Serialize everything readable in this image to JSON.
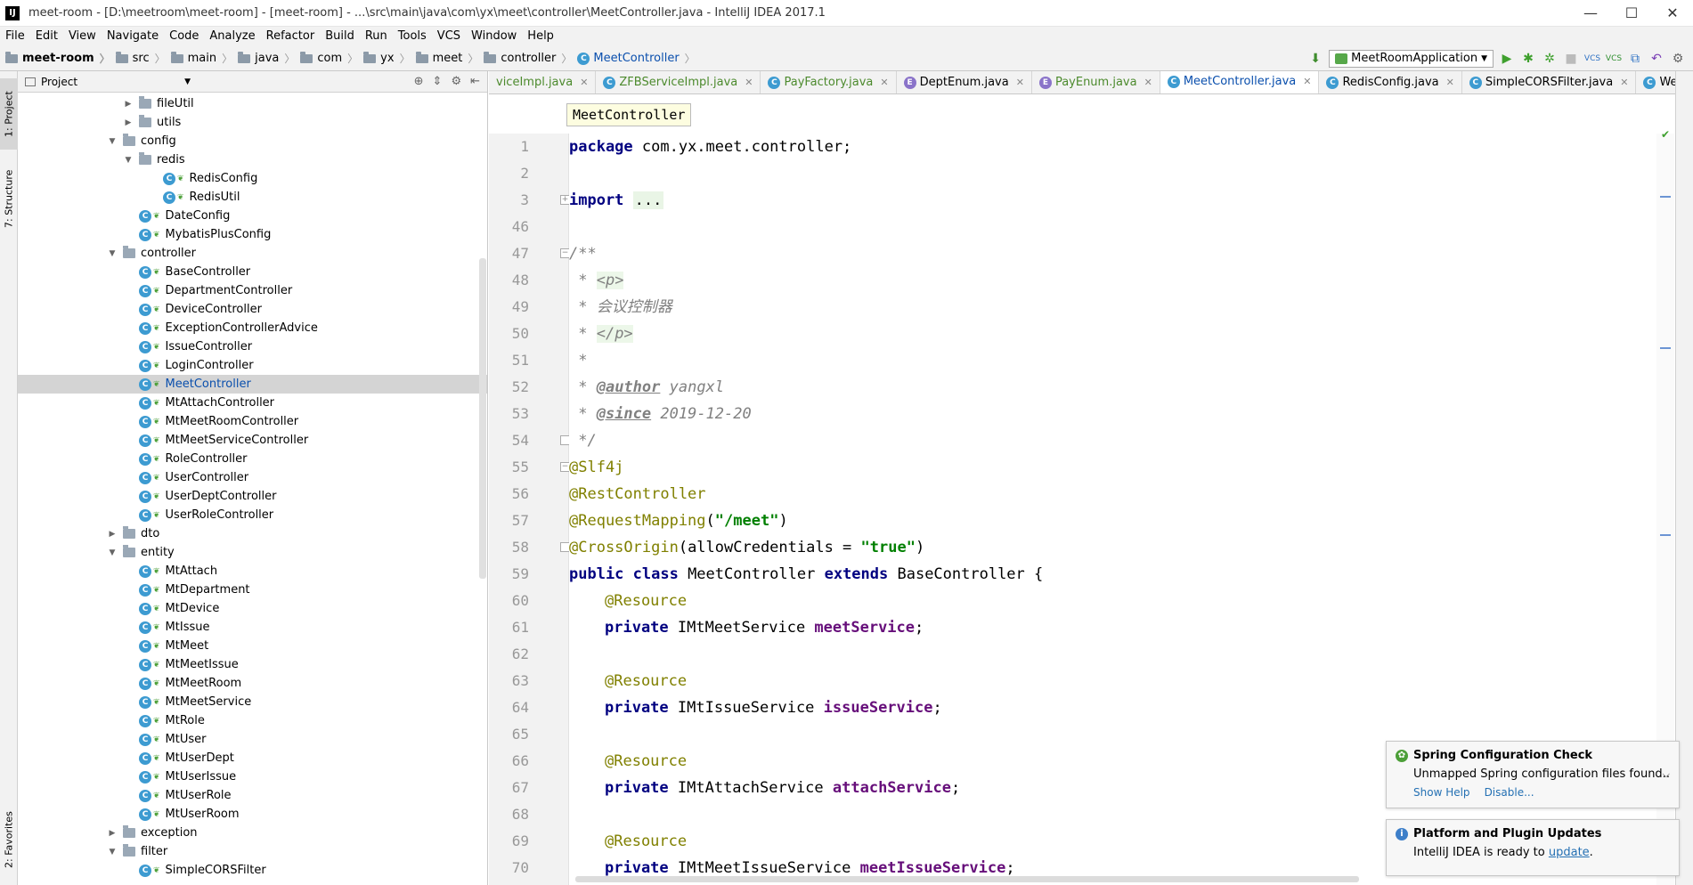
{
  "window": {
    "title": "meet-room - [D:\\meetroom\\meet-room] - [meet-room] - ...\\src\\main\\java\\com\\yx\\meet\\controller\\MeetController.java - IntelliJ IDEA 2017.1",
    "minimize": "—",
    "maximize": "☐",
    "close": "✕"
  },
  "menu": [
    "File",
    "Edit",
    "View",
    "Navigate",
    "Code",
    "Analyze",
    "Refactor",
    "Build",
    "Run",
    "Tools",
    "VCS",
    "Window",
    "Help"
  ],
  "breadcrumb": {
    "project": "meet-room",
    "items": [
      "src",
      "main",
      "java",
      "com",
      "yx",
      "meet",
      "controller"
    ],
    "file": "MeetController"
  },
  "run_config": "MeetRoomApplication",
  "side_tabs": {
    "project": "1: Project",
    "structure": "7: Structure",
    "favorites": "2: Favorites"
  },
  "project_panel": {
    "title": "Project",
    "tree": [
      {
        "label": "fileUtil",
        "type": "pkg",
        "depth": 1,
        "arrow": "▶"
      },
      {
        "label": "utils",
        "type": "pkg",
        "depth": 1,
        "arrow": "▶"
      },
      {
        "label": "config",
        "type": "pkg",
        "depth": 0,
        "arrow": "▼"
      },
      {
        "label": "redis",
        "type": "pkg",
        "depth": 1,
        "arrow": "▼"
      },
      {
        "label": "RedisConfig",
        "type": "class",
        "depth": 2
      },
      {
        "label": "RedisUtil",
        "type": "class",
        "depth": 2
      },
      {
        "label": "DateConfig",
        "type": "class",
        "depth": 1
      },
      {
        "label": "MybatisPlusConfig",
        "type": "class",
        "depth": 1
      },
      {
        "label": "controller",
        "type": "pkg",
        "depth": 0,
        "arrow": "▼"
      },
      {
        "label": "BaseController",
        "type": "class",
        "depth": 1
      },
      {
        "label": "DepartmentController",
        "type": "class",
        "depth": 1
      },
      {
        "label": "DeviceController",
        "type": "class",
        "depth": 1
      },
      {
        "label": "ExceptionControllerAdvice",
        "type": "class",
        "depth": 1
      },
      {
        "label": "IssueController",
        "type": "class",
        "depth": 1
      },
      {
        "label": "LoginController",
        "type": "class",
        "depth": 1
      },
      {
        "label": "MeetController",
        "type": "class",
        "depth": 1,
        "selected": true
      },
      {
        "label": "MtAttachController",
        "type": "class",
        "depth": 1
      },
      {
        "label": "MtMeetRoomController",
        "type": "class",
        "depth": 1
      },
      {
        "label": "MtMeetServiceController",
        "type": "class",
        "depth": 1
      },
      {
        "label": "RoleController",
        "type": "class",
        "depth": 1
      },
      {
        "label": "UserController",
        "type": "class",
        "depth": 1
      },
      {
        "label": "UserDeptController",
        "type": "class",
        "depth": 1
      },
      {
        "label": "UserRoleController",
        "type": "class",
        "depth": 1
      },
      {
        "label": "dto",
        "type": "pkg",
        "depth": 0,
        "arrow": "▶"
      },
      {
        "label": "entity",
        "type": "pkg",
        "depth": 0,
        "arrow": "▼"
      },
      {
        "label": "MtAttach",
        "type": "class",
        "depth": 1
      },
      {
        "label": "MtDepartment",
        "type": "class",
        "depth": 1
      },
      {
        "label": "MtDevice",
        "type": "class",
        "depth": 1
      },
      {
        "label": "MtIssue",
        "type": "class",
        "depth": 1
      },
      {
        "label": "MtMeet",
        "type": "class",
        "depth": 1
      },
      {
        "label": "MtMeetIssue",
        "type": "class",
        "depth": 1
      },
      {
        "label": "MtMeetRoom",
        "type": "class",
        "depth": 1
      },
      {
        "label": "MtMeetService",
        "type": "class",
        "depth": 1
      },
      {
        "label": "MtRole",
        "type": "class",
        "depth": 1
      },
      {
        "label": "MtUser",
        "type": "class",
        "depth": 1
      },
      {
        "label": "MtUserDept",
        "type": "class",
        "depth": 1
      },
      {
        "label": "MtUserIssue",
        "type": "class",
        "depth": 1
      },
      {
        "label": "MtUserRole",
        "type": "class",
        "depth": 1
      },
      {
        "label": "MtUserRoom",
        "type": "class",
        "depth": 1
      },
      {
        "label": "exception",
        "type": "pkg",
        "depth": 0,
        "arrow": "▶"
      },
      {
        "label": "filter",
        "type": "pkg",
        "depth": 0,
        "arrow": "▼"
      },
      {
        "label": "SimpleCORSFilter",
        "type": "class",
        "depth": 1
      }
    ]
  },
  "editor_tabs": [
    {
      "label": "viceImpl.java",
      "kind": "class",
      "green": true
    },
    {
      "label": "ZFBServiceImpl.java",
      "kind": "class",
      "green": true
    },
    {
      "label": "PayFactory.java",
      "kind": "class",
      "green": true
    },
    {
      "label": "DeptEnum.java",
      "kind": "enum",
      "green": false
    },
    {
      "label": "PayEnum.java",
      "kind": "enum",
      "green": true
    },
    {
      "label": "MeetController.java",
      "kind": "class",
      "green": false,
      "active": true
    },
    {
      "label": "RedisConfig.java",
      "kind": "class",
      "green": false
    },
    {
      "label": "SimpleCORSFilter.java",
      "kind": "class",
      "green": false
    },
    {
      "label": "WebMvcConfig.java",
      "kind": "class",
      "green": false
    }
  ],
  "editor": {
    "class_tip": "MeetController",
    "line_numbers": [
      "1",
      "2",
      "3",
      "46",
      "47",
      "48",
      "49",
      "50",
      "51",
      "52",
      "53",
      "54",
      "55",
      "56",
      "57",
      "58",
      "59",
      "60",
      "61",
      "62",
      "63",
      "64",
      "65",
      "66",
      "67",
      "68",
      "69",
      "70"
    ],
    "code": {
      "l1_kw": "package",
      "l1_rest": " com.yx.meet.controller;",
      "l3_kw": "import",
      "l3_folded": "...",
      "l47": "/**",
      "l48_star": " * ",
      "l48_tag": "<p>",
      "l49": " * 会议控制器",
      "l50_star": " * ",
      "l50_tag": "</p>",
      "l51": " *",
      "l52_star": " * ",
      "l52_tag": "@author",
      "l52_val": " yangxl",
      "l53_star": " * ",
      "l53_tag": "@since",
      "l53_val": " 2019-12-20",
      "l54": " */",
      "l55": "@Slf4j",
      "l56": "@RestController",
      "l57_ann": "@RequestMapping",
      "l57_p1": "(",
      "l57_str": "\"/meet\"",
      "l57_p2": ")",
      "l58_ann": "@CrossOrigin",
      "l58_p1": "(allowCredentials = ",
      "l58_str": "\"true\"",
      "l58_p2": ")",
      "l59_kw1": "public class",
      "l59_name": " MeetController ",
      "l59_kw2": "extends",
      "l59_rest": " BaseController {",
      "resource": "@Resource",
      "private_kw": "private",
      "l61_type": " IMtMeetService ",
      "l61_field": "meetService",
      "l64_type": " IMtIssueService ",
      "l64_field": "issueService",
      "l67_type": " IMtAttachService ",
      "l67_field": "attachService",
      "l70_type": " IMtMeetIssueService ",
      "l70_field": "meetIssueService",
      "semicolon": ";"
    }
  },
  "notifications": [
    {
      "title": "Spring Configuration Check",
      "body": "Unmapped Spring configuration files found....",
      "links": [
        "Show Help",
        "Disable..."
      ],
      "icon_color": "#4c9f38"
    },
    {
      "title": "Platform and Plugin Updates",
      "body_prefix": "IntelliJ IDEA is ready to ",
      "body_link": "update",
      "body_suffix": ".",
      "icon_color": "#3d7fc9"
    }
  ]
}
